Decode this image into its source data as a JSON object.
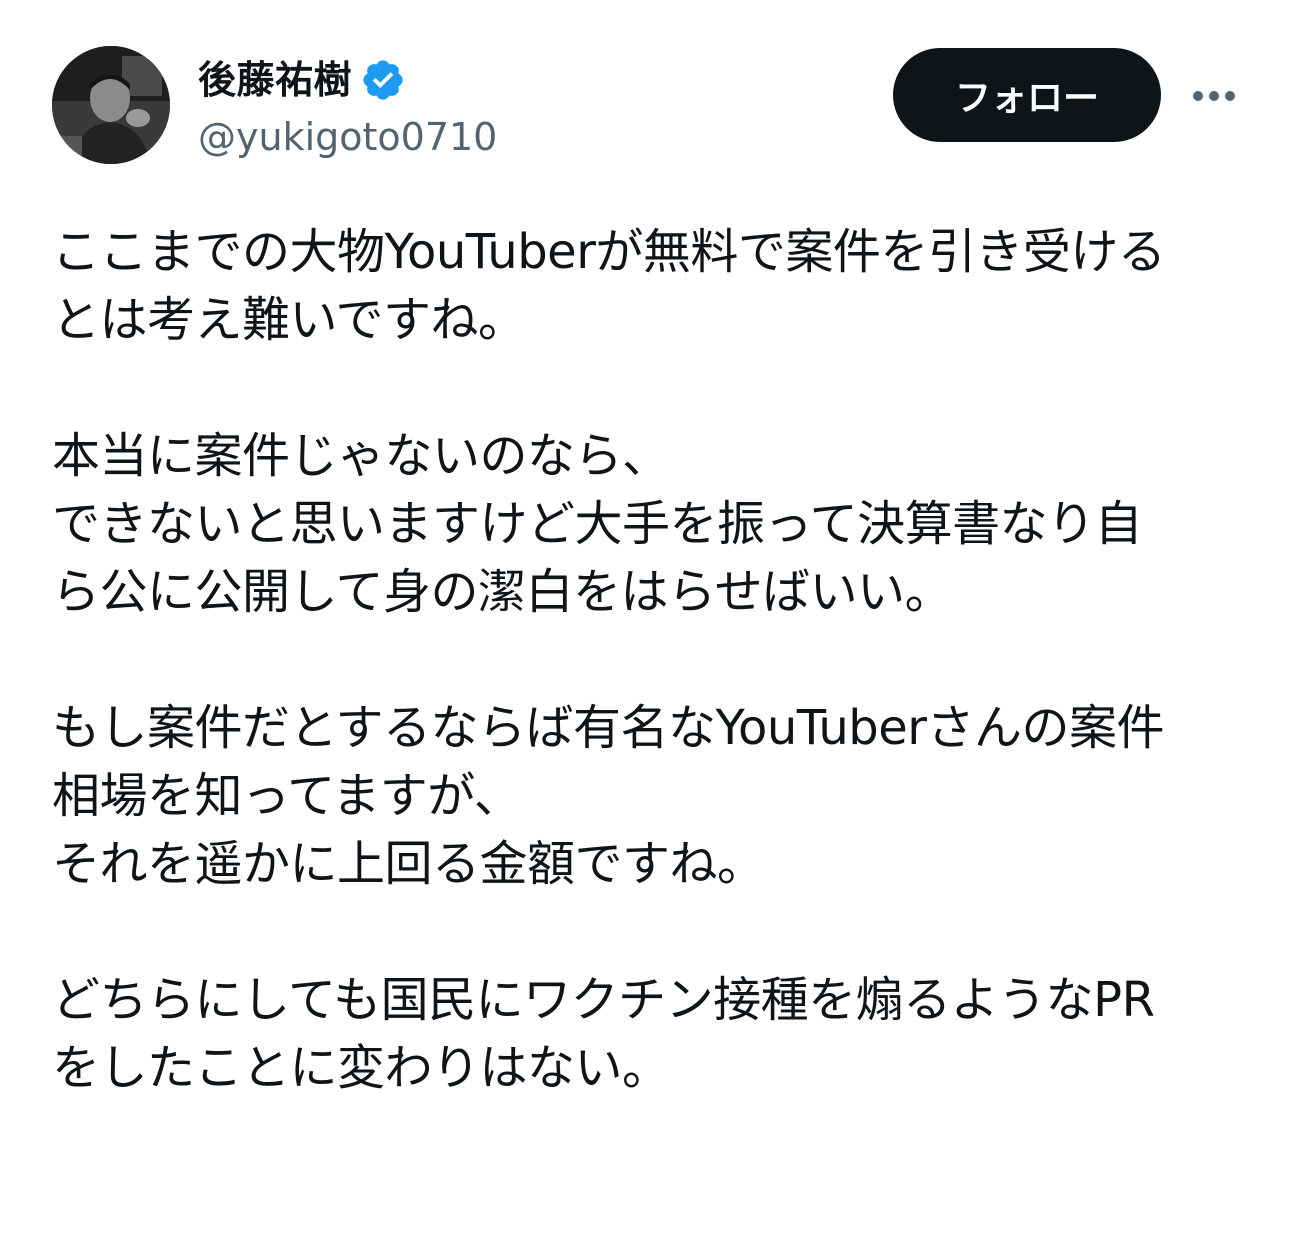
{
  "author": {
    "display_name": "後藤祐樹",
    "handle": "@yukigoto0710",
    "verified": true,
    "avatar_icon": "user-photo-avatar"
  },
  "actions": {
    "follow_label": "フォロー",
    "more_icon": "more-horizontal-icon"
  },
  "tweet": {
    "paragraphs": [
      [
        "ここまでの大物YouTuberが無料で案件を引き受ける",
        "とは考え難いですね。"
      ],
      [
        "本当に案件じゃないのなら、",
        "できないと思いますけど大手を振って決算書なり自",
        "ら公に公開して身の潔白をはらせばいい。"
      ],
      [
        "もし案件だとするならば有名なYouTuberさんの案件",
        "相場を知ってますが、",
        "それを遥かに上回る金額ですね。"
      ],
      [
        "どちらにしても国民にワクチン接種を煽るようなPR",
        "をしたことに変わりはない。"
      ]
    ]
  },
  "colors": {
    "text_primary": "#0f1419",
    "text_secondary": "#536471",
    "verified_blue": "#1d9bf0",
    "follow_bg": "#0f1419",
    "follow_text": "#ffffff"
  }
}
